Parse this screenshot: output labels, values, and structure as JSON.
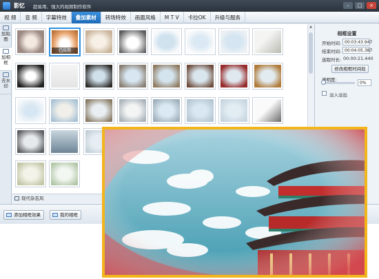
{
  "titlebar": {
    "app_name": "影忆",
    "slogan": "超易用、强大的视频制作软件",
    "minimize": "–",
    "maximize": "□",
    "close": "×"
  },
  "menu": [
    {
      "label": "视  频"
    },
    {
      "label": "音  频"
    },
    {
      "label": "字幕特效"
    },
    {
      "label": "叠加素材"
    },
    {
      "label": "转场特效"
    },
    {
      "label": "画面风格"
    },
    {
      "label": "M T V"
    },
    {
      "label": "卡拉OK"
    },
    {
      "label": "升级与服务"
    }
  ],
  "sidetabs": [
    {
      "label": "加贴图"
    },
    {
      "label": "加相框"
    },
    {
      "label": "去水印"
    }
  ],
  "thumbs": {
    "applied_badge": "已应用"
  },
  "category": {
    "label": "现代杂志风"
  },
  "buttons": {
    "add_frame": "添加相框效果",
    "my_frames": "我的相框"
  },
  "panel": {
    "title": "相框设置",
    "start_label": "开始时间:",
    "start_value": "00:03:43.947",
    "end_label": "结束时间:",
    "end_value": "00:04:05.387",
    "duration_label": "选取时长:",
    "duration_value": "00:00:21.440",
    "modify_button": "修改相框时间段",
    "opacity_label": "透明度:",
    "opacity_value": "0%",
    "opacity_level": 0,
    "fade_label": "淡入淡出"
  },
  "colors": {
    "accent": "#2f8fe0",
    "menu_active": "#1f6bb8",
    "preview_border": "#f3b51c"
  }
}
